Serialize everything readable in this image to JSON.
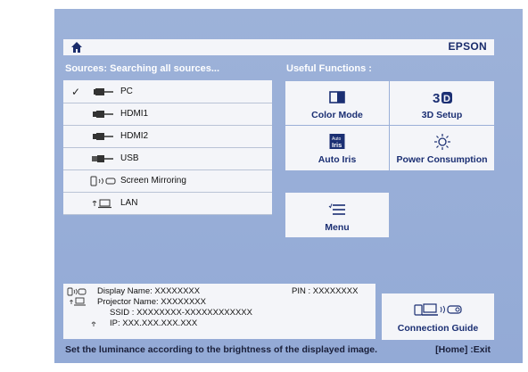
{
  "header": {
    "brand": "EPSON"
  },
  "sources": {
    "heading": "Sources: Searching all sources...",
    "items": [
      {
        "label": "PC",
        "selected": true,
        "icon": "pc-input-icon"
      },
      {
        "label": "HDMI1",
        "selected": false,
        "icon": "hdmi-icon"
      },
      {
        "label": "HDMI2",
        "selected": false,
        "icon": "hdmi-icon"
      },
      {
        "label": "USB",
        "selected": false,
        "icon": "usb-icon"
      },
      {
        "label": "Screen Mirroring",
        "selected": false,
        "icon": "screen-mirroring-icon"
      },
      {
        "label": "LAN",
        "selected": false,
        "icon": "lan-icon"
      }
    ],
    "check_mark": "✓"
  },
  "functions": {
    "heading": "Useful Functions :",
    "color_mode": "Color Mode",
    "setup_3d": "3D Setup",
    "auto_iris": "Auto Iris",
    "power_consumption": "Power Consumption",
    "menu": "Menu",
    "connection_guide": "Connection Guide"
  },
  "network_info": {
    "display_name": "Display Name:  XXXXXXXX",
    "projector_name": "Projector Name:  XXXXXXXX",
    "ssid": "SSID :  XXXXXXXX-XXXXXXXXXXXX",
    "ip": "IP:  XXX.XXX.XXX.XXX",
    "pin": "PIN :  XXXXXXXX"
  },
  "status": {
    "message": "Set the luminance according to the brightness of the displayed image.",
    "exit_hint": "[Home] :Exit"
  },
  "colors": {
    "panel": "#f4f5f9",
    "background": "#9db2d9",
    "label_text": "#1b2f73"
  }
}
